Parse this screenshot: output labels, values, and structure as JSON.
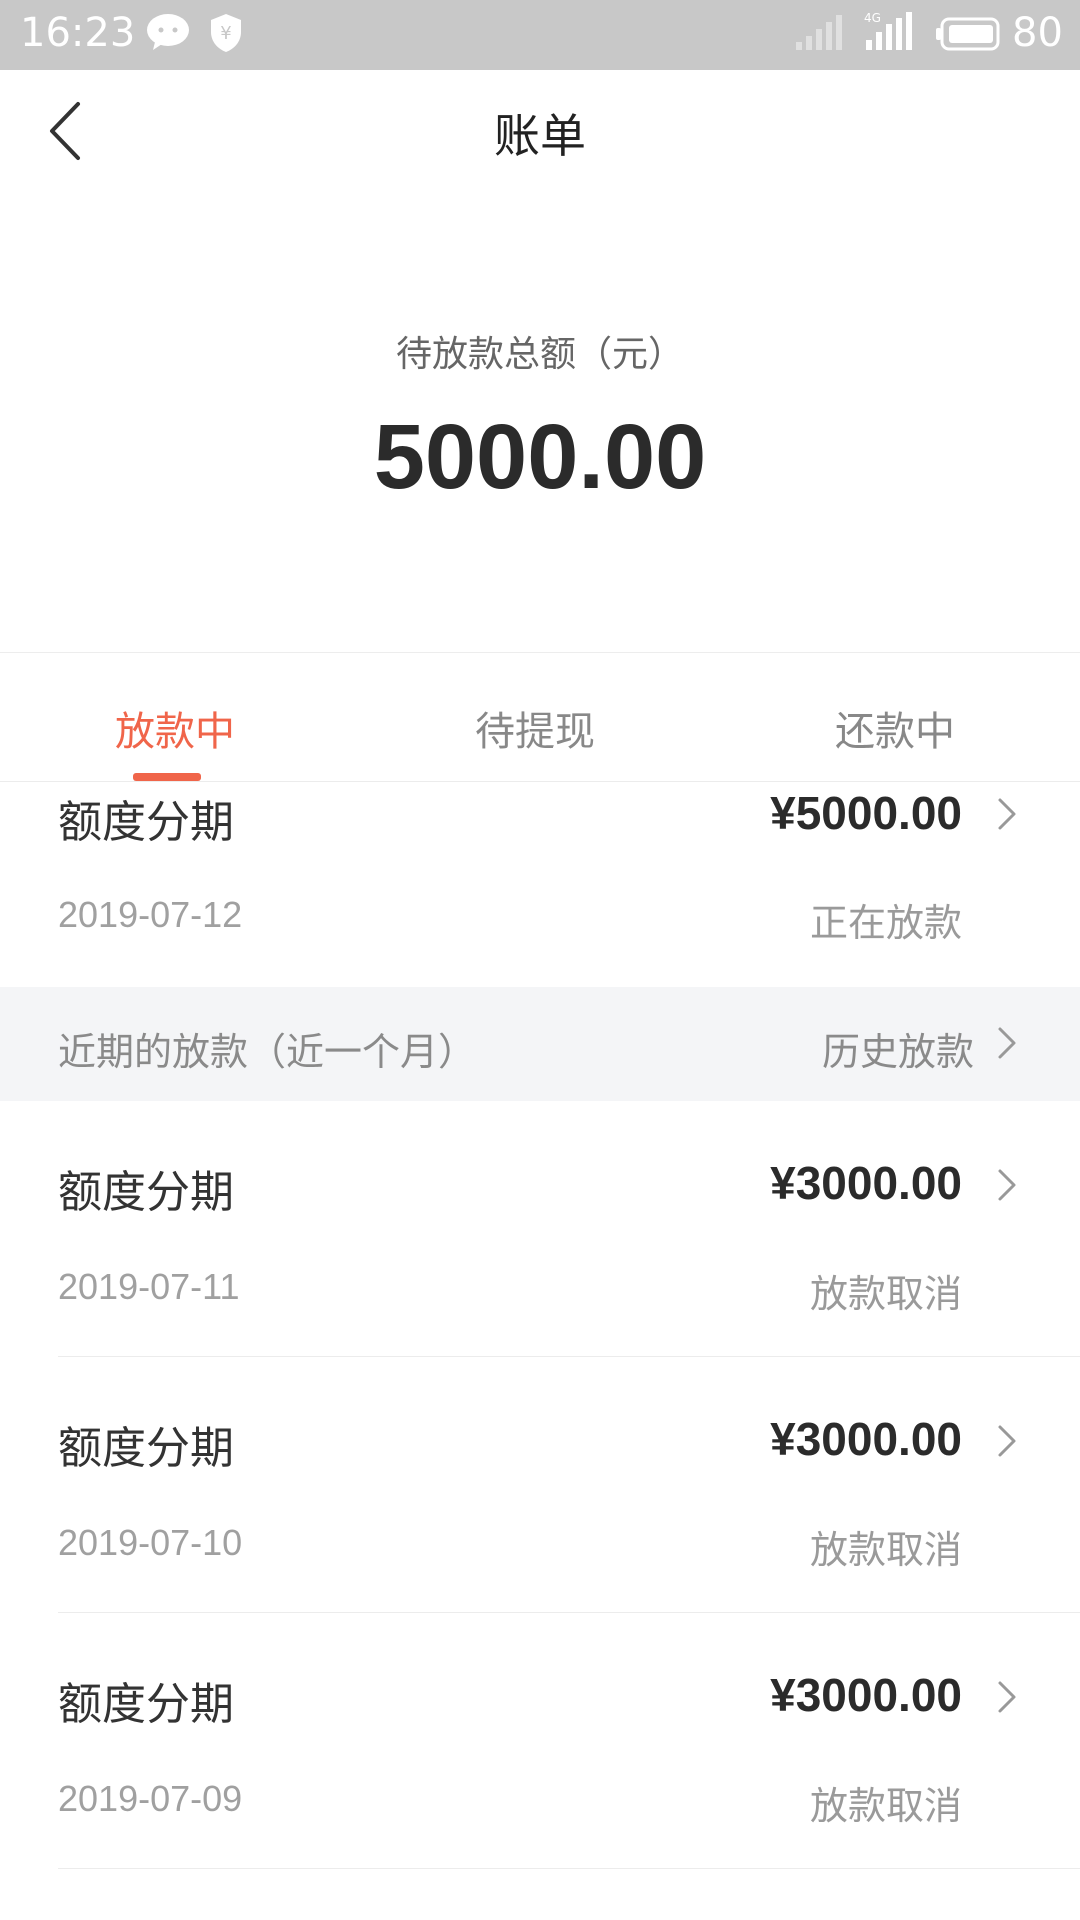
{
  "status_bar": {
    "time": "16:23",
    "network": "4G",
    "battery": "80"
  },
  "nav": {
    "title": "账单"
  },
  "summary": {
    "label": "待放款总额（元）",
    "amount": "5000.00"
  },
  "tabs": [
    {
      "label": "放款中",
      "active": true
    },
    {
      "label": "待提现",
      "active": false
    },
    {
      "label": "还款中",
      "active": false
    }
  ],
  "current_item": {
    "title": "额度分期",
    "amount": "¥5000.00",
    "date": "2019-07-12",
    "status": "正在放款"
  },
  "recent_section": {
    "title": "近期的放款（近一个月）",
    "link": "历史放款"
  },
  "recent_items": [
    {
      "title": "额度分期",
      "amount": "¥3000.00",
      "date": "2019-07-11",
      "status": "放款取消"
    },
    {
      "title": "额度分期",
      "amount": "¥3000.00",
      "date": "2019-07-10",
      "status": "放款取消"
    },
    {
      "title": "额度分期",
      "amount": "¥3000.00",
      "date": "2019-07-09",
      "status": "放款取消"
    }
  ],
  "colors": {
    "accent": "#f0654a",
    "status_bar": "#c8c8c8",
    "section_bg": "#f4f5f7"
  }
}
